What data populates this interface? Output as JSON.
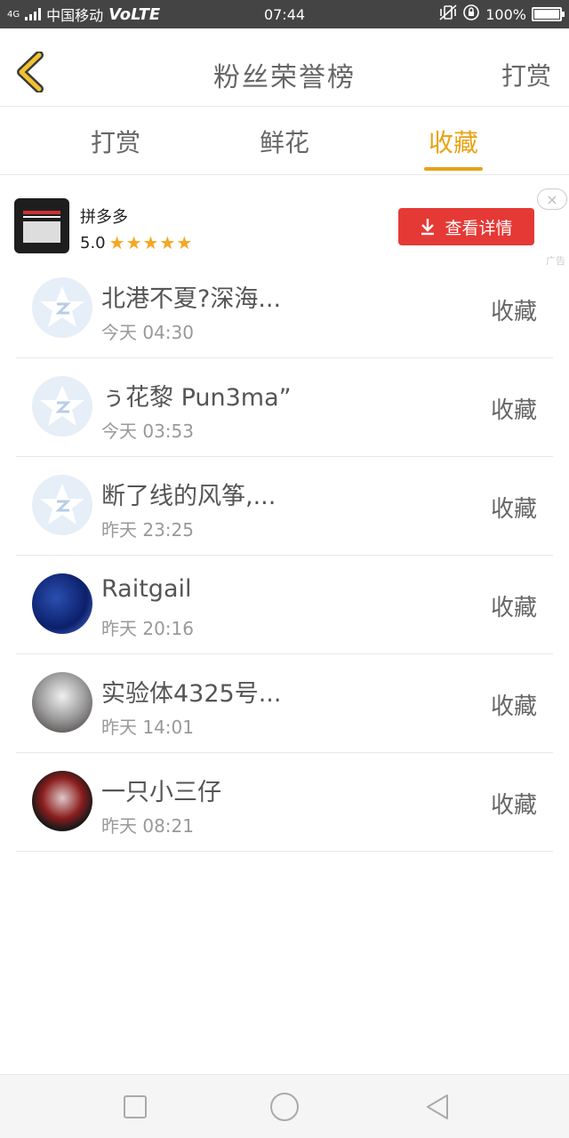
{
  "status_bar": {
    "network": "4G",
    "carrier": "中国移动",
    "volte": "VoLTE",
    "time": "07:44",
    "battery": "100%"
  },
  "header": {
    "title": "粉丝荣誉榜",
    "action_label": "打赏"
  },
  "tabs": [
    {
      "label": "打赏",
      "active": false
    },
    {
      "label": "鲜花",
      "active": false
    },
    {
      "label": "收藏",
      "active": true
    }
  ],
  "ad": {
    "app_name": "拼多多",
    "rating": "5.0",
    "stars": "★★★★★",
    "cta_label": "查看详情",
    "close_icon": "×",
    "ad_label": "广告"
  },
  "fans": [
    {
      "name": "北港不夏?深海...",
      "time": "今天 04:30",
      "action": "收藏",
      "avatar": "default"
    },
    {
      "name": "ぅ花黎 Pun3ma”",
      "time": "今天 03:53",
      "action": "收藏",
      "avatar": "default"
    },
    {
      "name": "断了线的风筝,...",
      "time": "昨天 23:25",
      "action": "收藏",
      "avatar": "default"
    },
    {
      "name": "Raitgail",
      "time": "昨天 20:16",
      "action": "收藏",
      "avatar": "photo-1"
    },
    {
      "name": "实验体4325号...",
      "time": "昨天 14:01",
      "action": "收藏",
      "avatar": "photo-2"
    },
    {
      "name": "一只小三仔",
      "time": "昨天 08:21",
      "action": "收藏",
      "avatar": "photo-3"
    }
  ],
  "colors": {
    "accent": "#e8a317",
    "cta": "#e53935",
    "status_bar": "#444444",
    "star": "#f5a623"
  },
  "icons": [
    "back-chevron-icon",
    "download-icon",
    "close-icon",
    "default-avatar-icon",
    "recent-apps-icon",
    "home-icon",
    "back-icon"
  ]
}
